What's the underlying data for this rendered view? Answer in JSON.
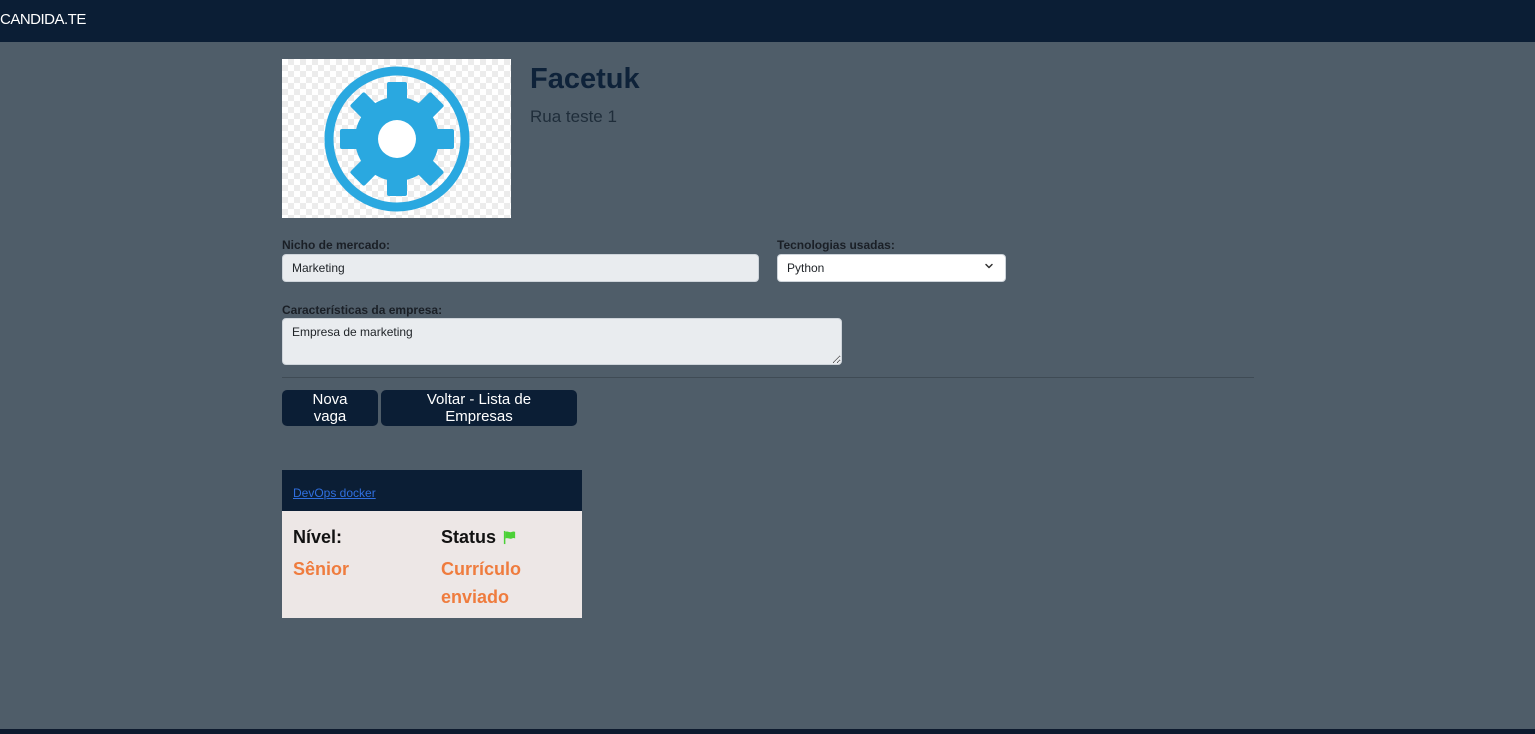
{
  "navbar": {
    "brand": "CANDIDA.TE"
  },
  "company": {
    "name": "Facetuk",
    "address": "Rua teste 1",
    "logo_icon": "gear-icon",
    "logo_color": "#2aa8e0"
  },
  "form": {
    "nicho_label": "Nicho de mercado:",
    "nicho_value": "Marketing",
    "tecnologias_label": "Tecnologias usadas:",
    "tecnologias_selected": "Python",
    "caracteristicas_label": "Características da empresa:",
    "caracteristicas_value": "Empresa de marketing"
  },
  "actions": {
    "nova_vaga_label": "Nova vaga",
    "voltar_label": "Voltar - Lista de Empresas"
  },
  "jobs": [
    {
      "title": "DevOps docker",
      "nivel_label": "Nível:",
      "nivel_value": "Sênior",
      "status_label": "Status",
      "status_value": "Currículo enviado",
      "status_icon": "flag-icon",
      "status_icon_color": "#4cd137"
    }
  ],
  "colors": {
    "navbar": "#0b1e35",
    "background": "#4f5d69",
    "accent": "#ef7c3e"
  }
}
